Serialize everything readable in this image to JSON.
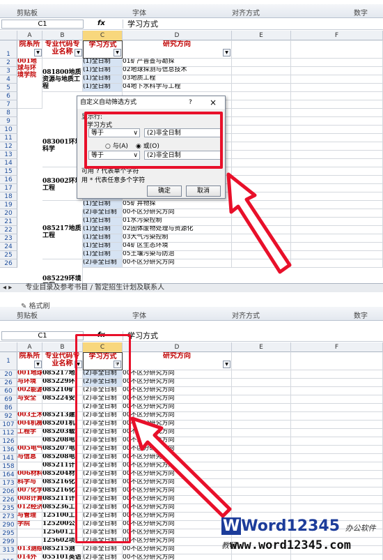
{
  "top": {
    "ribbon": {
      "groups": [
        "剪贴板",
        "字体",
        "对齐方式",
        "数字"
      ]
    },
    "name_box": "C1",
    "formula_value": "学习方式",
    "col_letters": [
      "A",
      "B",
      "C",
      "D",
      "E",
      "F"
    ],
    "headers": {
      "a": "院系所",
      "b": "专业代码专业名称",
      "c": "学习方式",
      "d": "研究方向"
    },
    "row_numbers": [
      "1",
      "2",
      "3",
      "4",
      "5",
      "6",
      "7",
      "8",
      "9",
      "10",
      "11",
      "12",
      "13",
      "14",
      "15",
      "16",
      "17",
      "18",
      "19",
      "20",
      "21",
      "22",
      "23",
      "24",
      "25",
      "26"
    ],
    "a_col": [
      {
        "text": "001地球与环境学院"
      }
    ],
    "b_col": [
      {
        "text": "081800地质资源与地质工程"
      },
      {
        "text": "083001环境科学"
      },
      {
        "text": "083002环境工程"
      },
      {
        "text": "085217地质工程"
      },
      {
        "text": "085229环境工程"
      }
    ],
    "c_col": [
      "(1)全日制",
      "(1)全日制",
      "(1)全日制",
      "(1)全日制",
      "",
      "",
      "",
      "",
      "",
      "",
      "",
      "",
      "",
      "",
      "",
      "(1)全日制",
      "(1)全日制",
      "(1)全日制",
      "(2)非全日制",
      "(1)全日制",
      "(1)全日制",
      "(1)全日制",
      "(1)全日制",
      "(1)全日制",
      "(2)非全日制"
    ],
    "d_col": [
      "01矿产普查与勘探",
      "02地球探测与信息技术",
      "03地质工程",
      "04地下水科学与工程",
      "",
      "",
      "",
      "",
      "",
      "",
      "",
      "",
      "",
      "",
      "",
      "03岩土工程测试技术",
      "04煤炭资源勘查与评价",
      "05矿井物探",
      "00不区分研究方向",
      "01水污染控制",
      "02固体废物处理与资源化",
      "03大气污染控制",
      "04矿区生态环境",
      "05土壤污染与防治",
      "00不区分研究方向"
    ],
    "sheet_tab": "专业目录及参考书目 / 暂定招生计划及联系人",
    "dialog": {
      "title": "自定义自动筛选方式",
      "help": "?",
      "close": "×",
      "section": "显示行:",
      "field": "学习方式",
      "op1": "等于",
      "val1": "(2)非全日制",
      "and_label": "与(A)",
      "or_label": "或(O)",
      "op2": "等于",
      "val2": "(2)非全日制",
      "hint1": "可用 ? 代表单个字符",
      "hint2": "用 * 代表任意多个字符",
      "ok": "确定",
      "cancel": "取消"
    }
  },
  "bottom": {
    "ribbon": {
      "format_painter": "格式刷",
      "groups": [
        "剪贴板",
        "字体",
        "对齐方式",
        "数字"
      ]
    },
    "name_box": "C1",
    "formula_value": "学习方式",
    "headers": {
      "a": "院系所",
      "b": "专业代码专业名称",
      "c": "学习方式",
      "d": "研究方向"
    },
    "rows": [
      {
        "n": "1",
        "a": "",
        "b": "",
        "c": "",
        "d": ""
      },
      {
        "n": "20",
        "a": "001地球",
        "b": "085217地",
        "c": "(2)非全日制",
        "d": "00不区分研究方向"
      },
      {
        "n": "26",
        "a": "与环境",
        "b": "085229环",
        "c": "(2)非全日制",
        "d": "00不区分研究方向"
      },
      {
        "n": "60",
        "a": "002能源",
        "b": "085210矿",
        "c": "(2)非全日制",
        "d": "00不区分研究方向"
      },
      {
        "n": "69",
        "a": "与安全",
        "b": "085224安",
        "c": "(2)非全日制",
        "d": "00不区分研究方向"
      },
      {
        "n": "86",
        "a": "",
        "b": "",
        "c": "(2)非全日制",
        "d": "00不区分研究方向"
      },
      {
        "n": "92",
        "a": "003土木",
        "b": "085213建",
        "c": "(2)非全日制",
        "d": "00不区分研究方向"
      },
      {
        "n": "107",
        "a": "004机械",
        "b": "085201机",
        "c": "(2)非全日制",
        "d": "00不区分研究方向"
      },
      {
        "n": "112",
        "a": "工程学",
        "b": "085203载",
        "c": "(2)非全日制",
        "d": "00不区分研究方向"
      },
      {
        "n": "126",
        "a": "",
        "b": "085208电",
        "c": "(2)非全日制",
        "d": "00不区分研究方向"
      },
      {
        "n": "136",
        "a": "005电气",
        "b": "085207电",
        "c": "(2)非全日制",
        "d": "00不区分研究方向"
      },
      {
        "n": "141",
        "a": "与信息",
        "b": "085208电",
        "c": "(2)非全日制",
        "d": "00不区分研究方向"
      },
      {
        "n": "158",
        "a": "",
        "b": "085211计",
        "c": "(2)非全日制",
        "d": "00不区分研究方向"
      },
      {
        "n": "164",
        "a": "006材料",
        "b": "085204材",
        "c": "(2)非全日制",
        "d": "00不区分研究方向"
      },
      {
        "n": "173",
        "a": "科学与",
        "b": "085216化",
        "c": "(2)非全日制",
        "d": "00不区分研究方向"
      },
      {
        "n": "206",
        "a": "007化学",
        "b": "085216化",
        "c": "(2)非全日制",
        "d": "00不区分研究方向"
      },
      {
        "n": "226",
        "a": "008计算",
        "b": "085211计",
        "c": "(2)非全日制",
        "d": "00不区分研究方向"
      },
      {
        "n": "235",
        "a": "012经济",
        "b": "085236工",
        "c": "(2)非全日制",
        "d": "00不区分研究方向"
      },
      {
        "n": "273",
        "a": "与管理",
        "b": "125100工",
        "c": "(2)非全日制",
        "d": "00不区分研究方向"
      },
      {
        "n": "290",
        "a": "学院",
        "b": "125200公",
        "c": "(2)非全日制",
        "d": "00不区分研究方向"
      },
      {
        "n": "295",
        "a": "",
        "b": "125601工",
        "c": "(2)非全日制",
        "d": "00不区分研究方向"
      },
      {
        "n": "299",
        "a": "",
        "b": "125602项",
        "c": "(2)非全日制",
        "d": "00不区分研究方向"
      },
      {
        "n": "313",
        "a": "013测绘",
        "b": "085215测",
        "c": "(2)非全日制",
        "d": "00不区分研究方向"
      },
      {
        "n": "315",
        "a": "014外国语学院",
        "b": "055101英语笔译",
        "c": "(2)非全日制",
        "d": "00不区分研究方向"
      }
    ]
  },
  "watermark": {
    "brand": "Word12345",
    "tag": "办公软件教程",
    "url": "www.word12345.com"
  },
  "colors": {
    "highlight": "#e8102a",
    "header_red": "#c00000",
    "selected_cell": "#d6e3f3"
  }
}
